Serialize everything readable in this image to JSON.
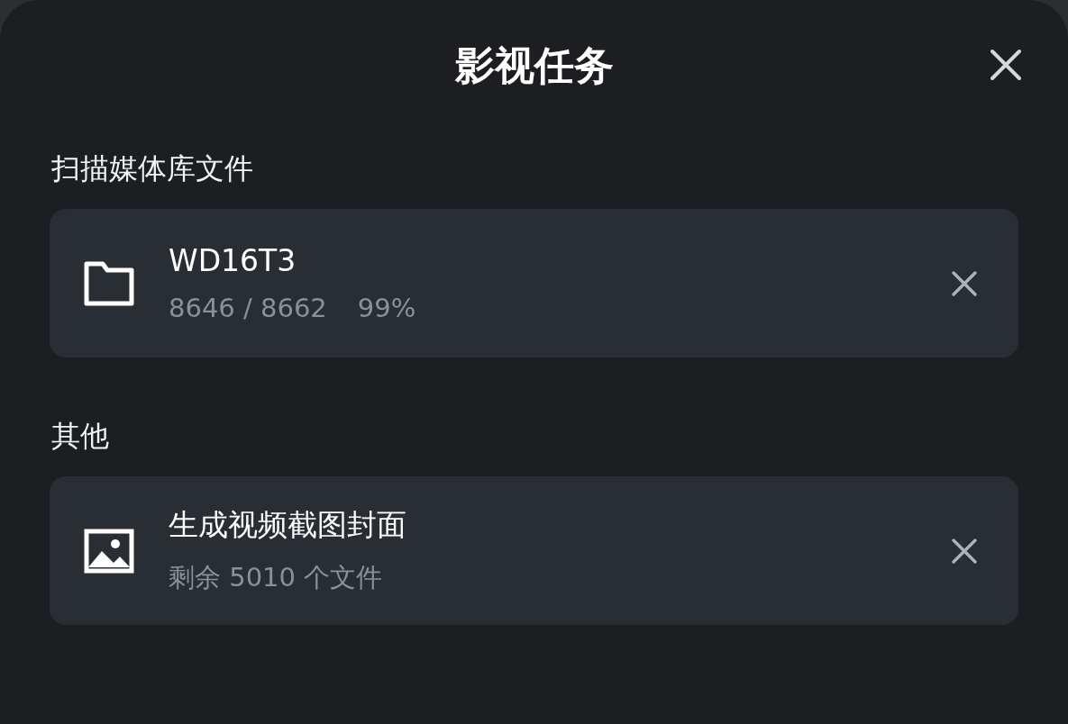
{
  "dialog": {
    "title": "影视任务"
  },
  "sections": [
    {
      "label": "扫描媒体库文件",
      "tasks": [
        {
          "kind": "folder",
          "name": "WD16T3",
          "details": [
            "8646 / 8662",
            "99%"
          ]
        }
      ]
    },
    {
      "label": "其他",
      "tasks": [
        {
          "kind": "image",
          "name": "生成视频截图封面",
          "details": [
            "剩余 5010 个文件"
          ]
        }
      ]
    }
  ]
}
